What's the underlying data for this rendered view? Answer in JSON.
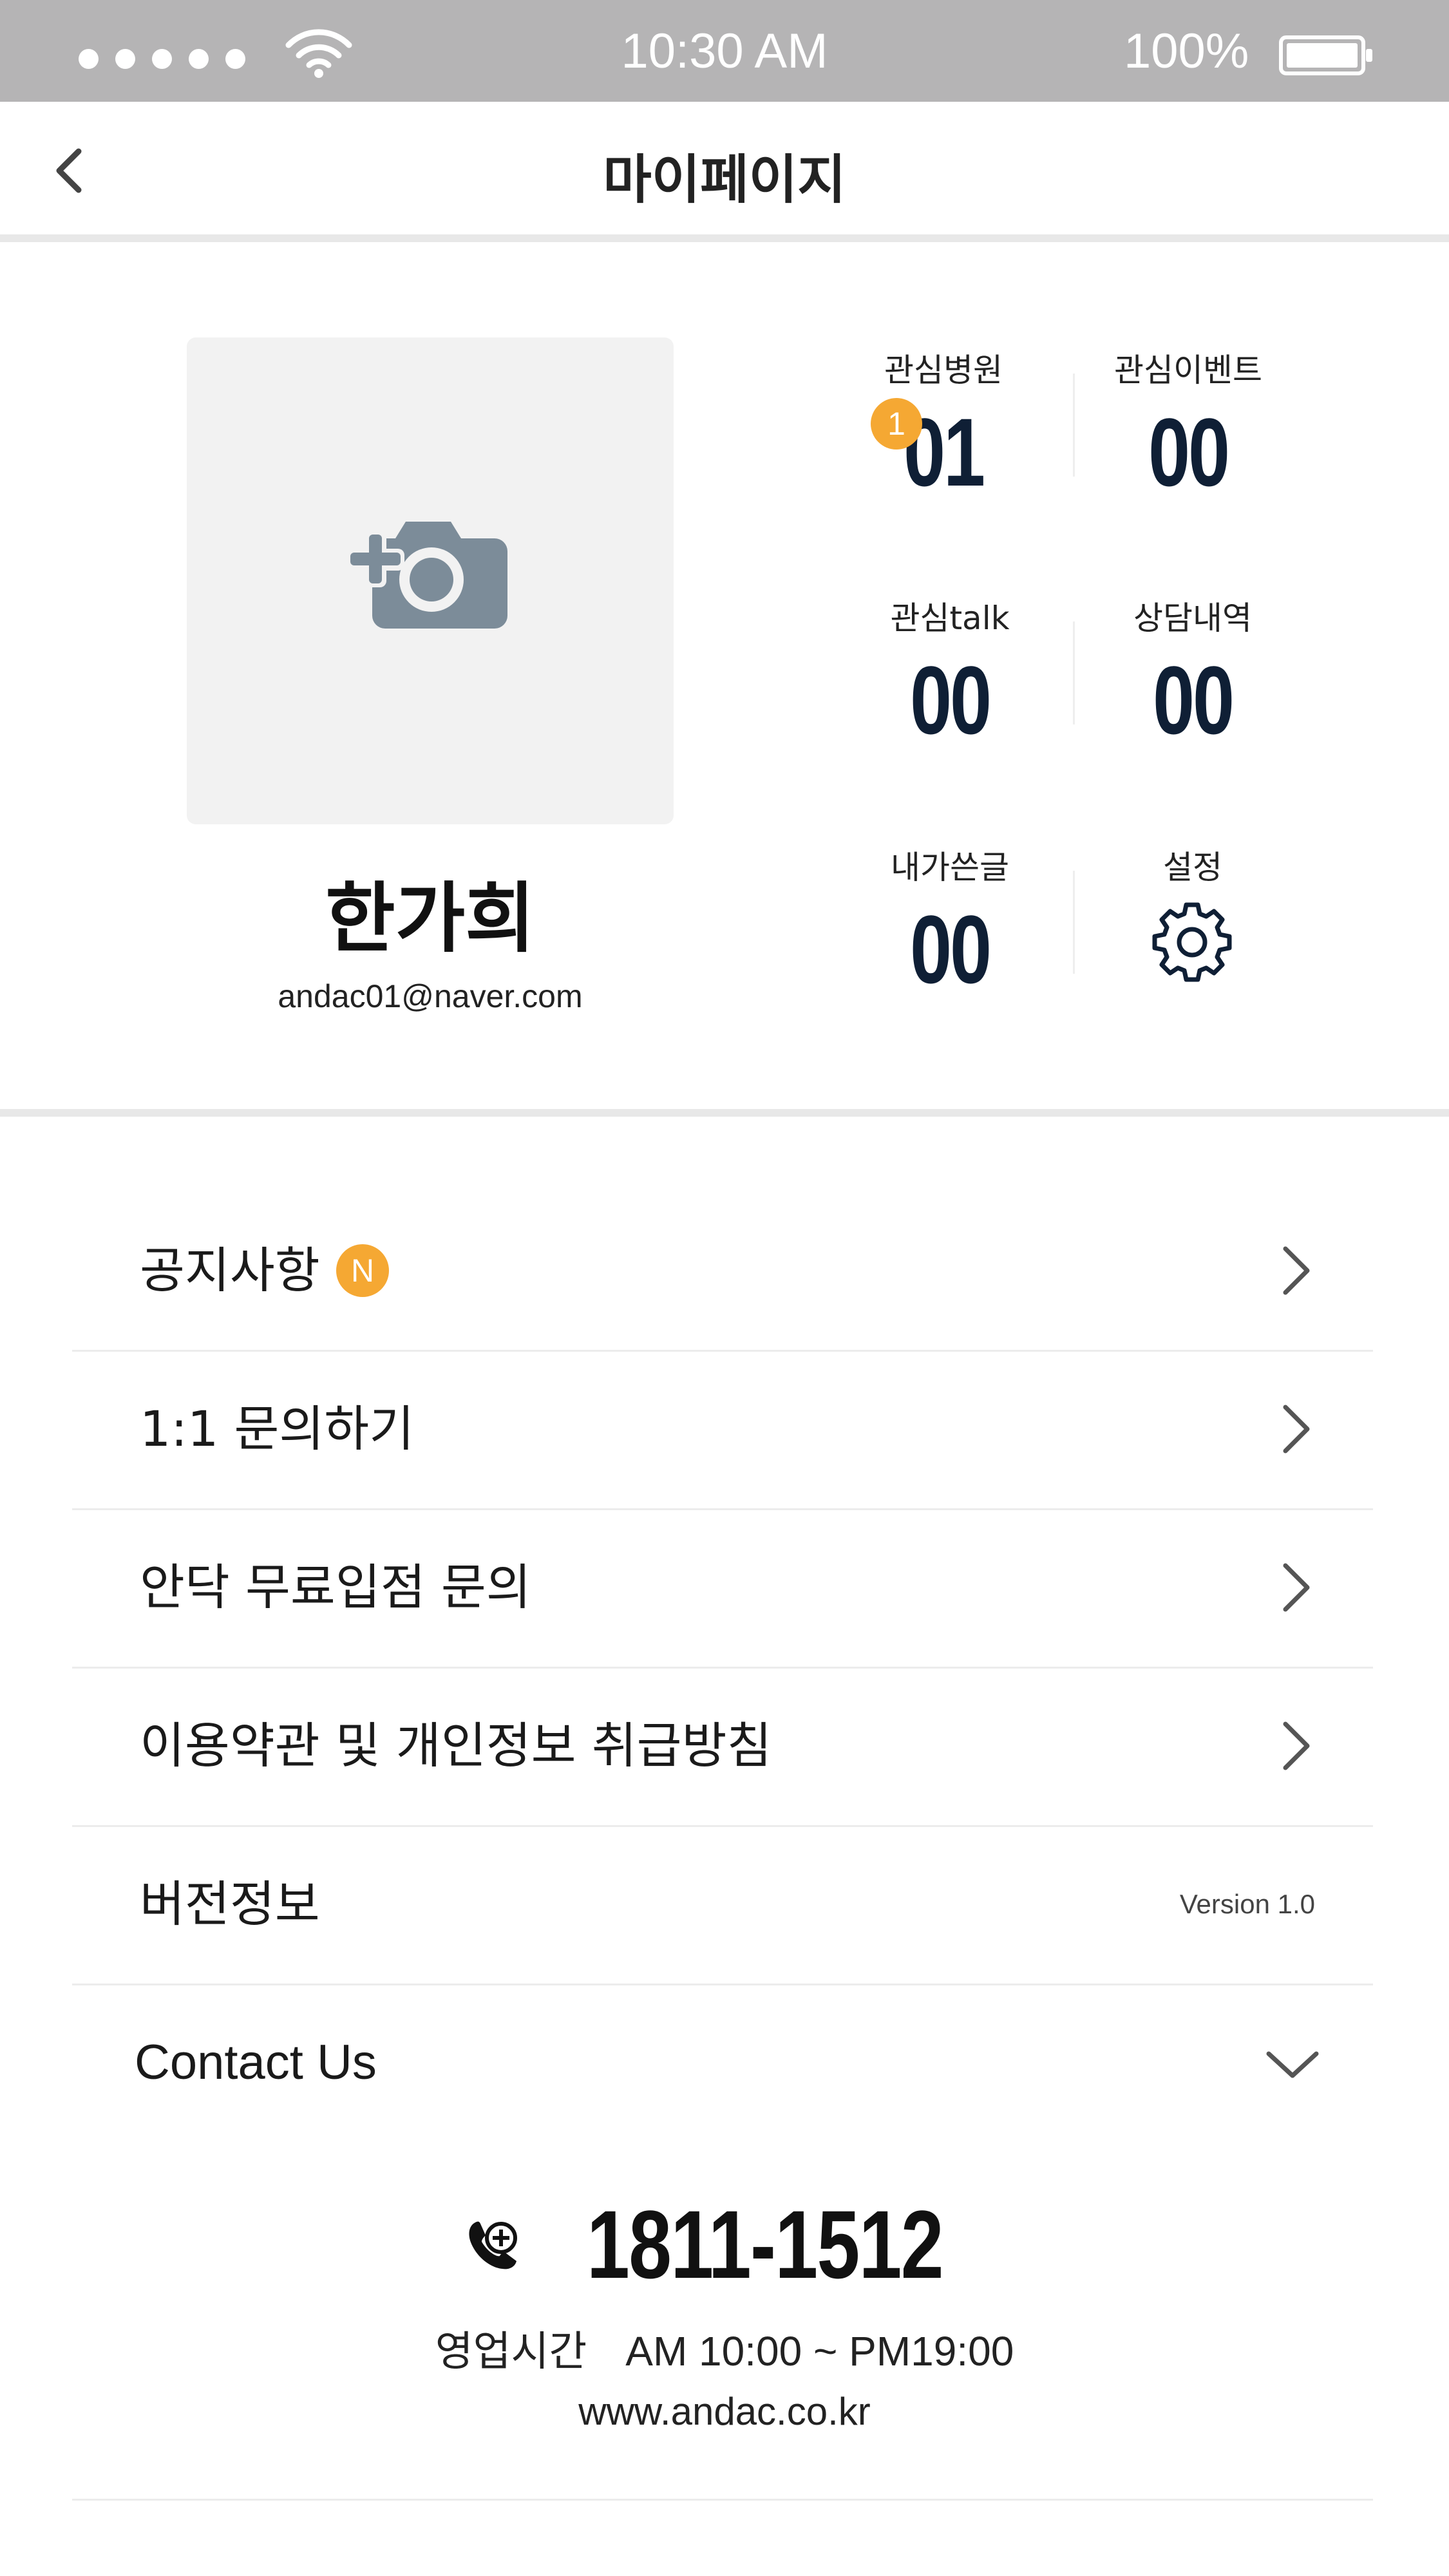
{
  "status_bar": {
    "time": "10:30 AM",
    "battery": "100%"
  },
  "header": {
    "title": "마이페이지"
  },
  "profile": {
    "name": "한가희",
    "email": "andac01@naver.com"
  },
  "stats": [
    {
      "label": "관심병원",
      "value": "01",
      "badge": "1"
    },
    {
      "label": "관심이벤트",
      "value": "00"
    },
    {
      "label": "관심talk",
      "value": "00"
    },
    {
      "label": "상담내역",
      "value": "00"
    },
    {
      "label": "내가쓴글",
      "value": "00"
    },
    {
      "label": "설정"
    }
  ],
  "menu": {
    "notice": {
      "label": "공지사항",
      "badge": "N"
    },
    "inquiry": {
      "label": "1:1 문의하기"
    },
    "free_entry": {
      "label": "안닥 무료입점 문의"
    },
    "terms": {
      "label": "이용약관 및 개인정보 취급방침"
    },
    "version": {
      "label": "버전정보",
      "value": "Version 1.0"
    },
    "contact": {
      "label": "Contact Us"
    }
  },
  "contact": {
    "phone": "1811-1512",
    "hours_label": "영업시간",
    "hours": "AM 10:00 ~ PM19:00",
    "website": "www.andac.co.kr"
  },
  "colors": {
    "accent": "#f5a833",
    "stat_number": "#0f1f35",
    "status_bar": "#b5b4b5"
  },
  "icons": [
    "wifi-icon",
    "battery-icon",
    "back-icon",
    "camera-add-icon",
    "gear-icon",
    "chevron-right-icon",
    "chevron-down-icon",
    "phone-icon"
  ]
}
